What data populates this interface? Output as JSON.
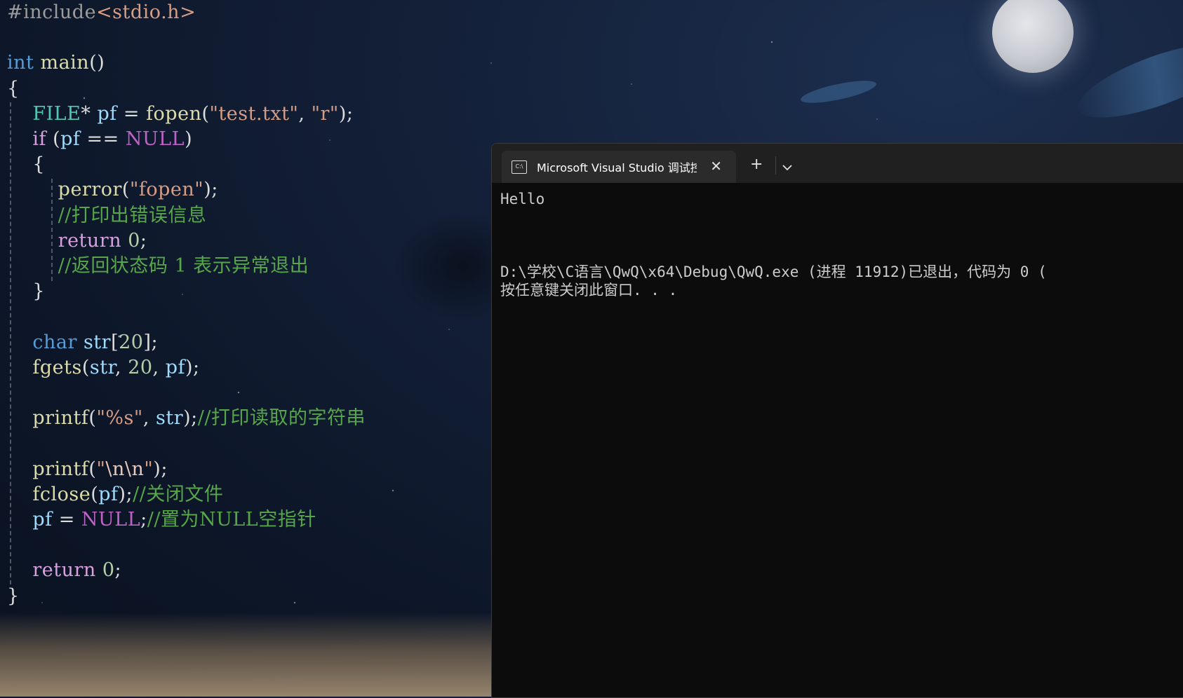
{
  "editor": {
    "lines": [
      {
        "tokens": [
          {
            "c": "pre",
            "t": "#include"
          },
          {
            "c": "str",
            "t": "<stdio.h>"
          }
        ]
      },
      {
        "tokens": []
      },
      {
        "tokens": [
          {
            "c": "kw",
            "t": "int"
          },
          {
            "c": "plain",
            "t": " "
          },
          {
            "c": "fn",
            "t": "main"
          },
          {
            "c": "plain",
            "t": "()"
          }
        ]
      },
      {
        "tokens": [
          {
            "c": "plain",
            "t": "{"
          }
        ]
      },
      {
        "tokens": [
          {
            "c": "plain",
            "t": "    "
          },
          {
            "c": "type",
            "t": "FILE"
          },
          {
            "c": "plain",
            "t": "* "
          },
          {
            "c": "var",
            "t": "pf"
          },
          {
            "c": "plain",
            "t": " = "
          },
          {
            "c": "fn",
            "t": "fopen"
          },
          {
            "c": "plain",
            "t": "("
          },
          {
            "c": "str",
            "t": "\"test.txt\""
          },
          {
            "c": "plain",
            "t": ", "
          },
          {
            "c": "str",
            "t": "\"r\""
          },
          {
            "c": "plain",
            "t": ");"
          }
        ]
      },
      {
        "tokens": [
          {
            "c": "plain",
            "t": "    "
          },
          {
            "c": "ctl",
            "t": "if"
          },
          {
            "c": "plain",
            "t": " ("
          },
          {
            "c": "var",
            "t": "pf"
          },
          {
            "c": "plain",
            "t": " == "
          },
          {
            "c": "mac",
            "t": "NULL"
          },
          {
            "c": "plain",
            "t": ")"
          }
        ]
      },
      {
        "tokens": [
          {
            "c": "plain",
            "t": "    {"
          }
        ]
      },
      {
        "tokens": [
          {
            "c": "plain",
            "t": "        "
          },
          {
            "c": "fn",
            "t": "perror"
          },
          {
            "c": "plain",
            "t": "("
          },
          {
            "c": "str",
            "t": "\"fopen\""
          },
          {
            "c": "plain",
            "t": ");"
          }
        ]
      },
      {
        "tokens": [
          {
            "c": "plain",
            "t": "        "
          },
          {
            "c": "cmt",
            "t": "//打印出错误信息"
          }
        ]
      },
      {
        "tokens": [
          {
            "c": "plain",
            "t": "        "
          },
          {
            "c": "ctl",
            "t": "return"
          },
          {
            "c": "plain",
            "t": " "
          },
          {
            "c": "num",
            "t": "0"
          },
          {
            "c": "plain",
            "t": ";"
          }
        ]
      },
      {
        "tokens": [
          {
            "c": "plain",
            "t": "        "
          },
          {
            "c": "cmt",
            "t": "//返回状态码 1 表示异常退出"
          }
        ]
      },
      {
        "tokens": [
          {
            "c": "plain",
            "t": "    }"
          }
        ]
      },
      {
        "tokens": []
      },
      {
        "tokens": [
          {
            "c": "plain",
            "t": "    "
          },
          {
            "c": "kw",
            "t": "char"
          },
          {
            "c": "plain",
            "t": " "
          },
          {
            "c": "var",
            "t": "str"
          },
          {
            "c": "plain",
            "t": "["
          },
          {
            "c": "num",
            "t": "20"
          },
          {
            "c": "plain",
            "t": "];"
          }
        ]
      },
      {
        "tokens": [
          {
            "c": "plain",
            "t": "    "
          },
          {
            "c": "fn",
            "t": "fgets"
          },
          {
            "c": "plain",
            "t": "("
          },
          {
            "c": "var",
            "t": "str"
          },
          {
            "c": "plain",
            "t": ", "
          },
          {
            "c": "num",
            "t": "20"
          },
          {
            "c": "plain",
            "t": ", "
          },
          {
            "c": "var",
            "t": "pf"
          },
          {
            "c": "plain",
            "t": ");"
          }
        ]
      },
      {
        "tokens": []
      },
      {
        "tokens": [
          {
            "c": "plain",
            "t": "    "
          },
          {
            "c": "fn",
            "t": "printf"
          },
          {
            "c": "plain",
            "t": "("
          },
          {
            "c": "str",
            "t": "\"%s\""
          },
          {
            "c": "plain",
            "t": ", "
          },
          {
            "c": "var",
            "t": "str"
          },
          {
            "c": "plain",
            "t": ");"
          },
          {
            "c": "cmt",
            "t": "//打印读取的字符串"
          }
        ]
      },
      {
        "tokens": []
      },
      {
        "tokens": [
          {
            "c": "plain",
            "t": "    "
          },
          {
            "c": "fn",
            "t": "printf"
          },
          {
            "c": "plain",
            "t": "("
          },
          {
            "c": "str",
            "t": "\""
          },
          {
            "c": "esc",
            "t": "\\n\\n"
          },
          {
            "c": "str",
            "t": "\""
          },
          {
            "c": "plain",
            "t": ");"
          }
        ]
      },
      {
        "tokens": [
          {
            "c": "plain",
            "t": "    "
          },
          {
            "c": "fn",
            "t": "fclose"
          },
          {
            "c": "plain",
            "t": "("
          },
          {
            "c": "var",
            "t": "pf"
          },
          {
            "c": "plain",
            "t": ");"
          },
          {
            "c": "cmt",
            "t": "//关闭文件"
          }
        ]
      },
      {
        "tokens": [
          {
            "c": "plain",
            "t": "    "
          },
          {
            "c": "var",
            "t": "pf"
          },
          {
            "c": "plain",
            "t": " = "
          },
          {
            "c": "mac",
            "t": "NULL"
          },
          {
            "c": "plain",
            "t": ";"
          },
          {
            "c": "cmt",
            "t": "//置为NULL空指针"
          }
        ]
      },
      {
        "tokens": []
      },
      {
        "tokens": [
          {
            "c": "plain",
            "t": "    "
          },
          {
            "c": "ctl",
            "t": "return"
          },
          {
            "c": "plain",
            "t": " "
          },
          {
            "c": "num",
            "t": "0"
          },
          {
            "c": "plain",
            "t": ";"
          }
        ]
      },
      {
        "tokens": [
          {
            "c": "plain",
            "t": "}"
          }
        ]
      }
    ]
  },
  "terminal": {
    "tab_title": "Microsoft Visual Studio 调试控",
    "tab_icon_text": "C:\\",
    "close_glyph": "✕",
    "new_tab_glyph": "+",
    "dropdown_icon": "chevron-down-icon",
    "output_lines": [
      "Hello",
      "",
      "",
      "",
      "D:\\学校\\C语言\\QwQ\\x64\\Debug\\QwQ.exe (进程 11912)已退出，代码为 0 (",
      "按任意键关闭此窗口. . ."
    ]
  }
}
